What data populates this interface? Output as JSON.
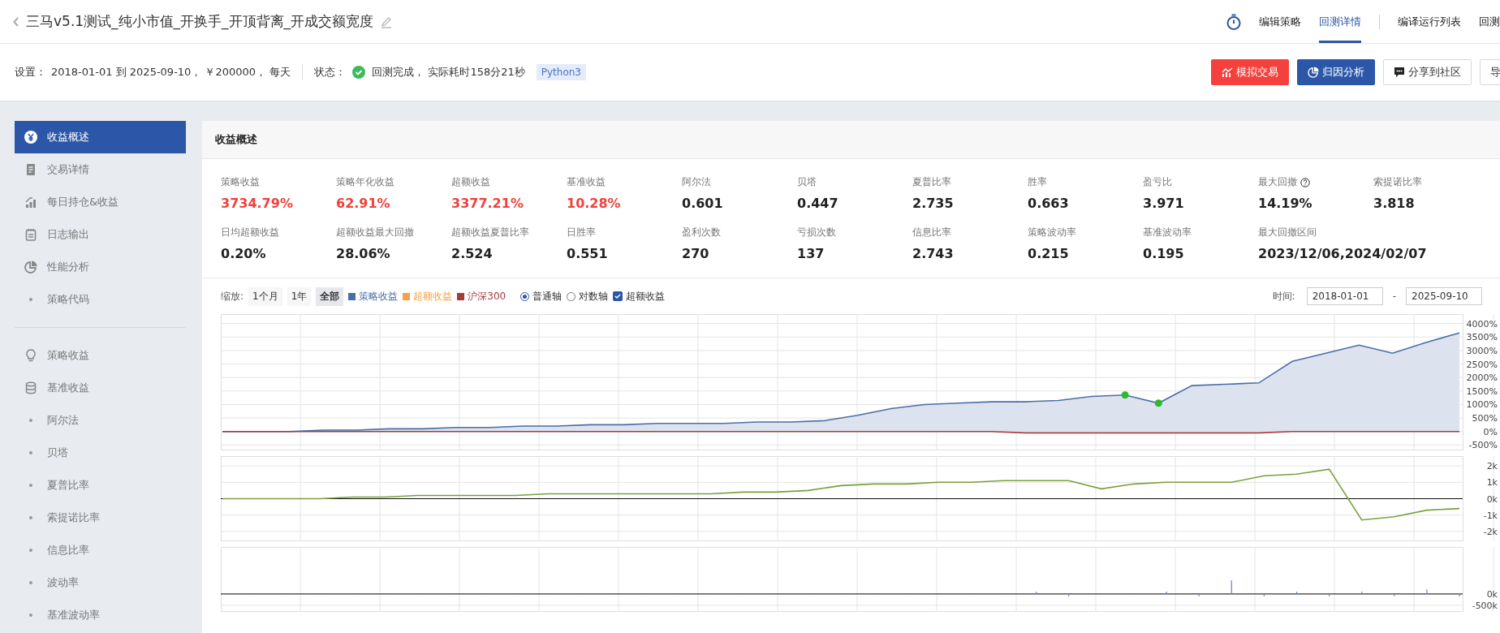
{
  "header": {
    "title": "三马v5.1测试_纯小市值_开换手_开顶背离_开成交额宽度",
    "nav": [
      {
        "label": "编辑策略",
        "selected": false
      },
      {
        "label": "回测详情",
        "selected": true
      },
      {
        "label": "编译运行列表",
        "selected": false
      },
      {
        "label": "回测",
        "selected": false
      }
    ]
  },
  "settings": {
    "label": "设置：",
    "value": "2018-01-01 到 2025-09-10， ￥200000， 每天",
    "status_label": "状态：",
    "status": "回测完成，  实际耗时158分21秒",
    "language": "Python3"
  },
  "actions": [
    {
      "label": "模拟交易",
      "kind": "danger"
    },
    {
      "label": "归因分析",
      "kind": "primary"
    },
    {
      "label": "分享到社区",
      "kind": "plain"
    },
    {
      "label": "导",
      "kind": "plain"
    }
  ],
  "sidebar": {
    "groups": [
      [
        {
          "label": "收益概述",
          "kind": "icon",
          "selected": true
        },
        {
          "label": "交易详情",
          "kind": "icon",
          "selected": false
        },
        {
          "label": "每日持仓&收益",
          "kind": "icon",
          "selected": false
        },
        {
          "label": "日志输出",
          "kind": "icon",
          "selected": false
        },
        {
          "label": "性能分析",
          "kind": "icon",
          "selected": false
        },
        {
          "label": "策略代码",
          "kind": "bullet",
          "selected": false
        }
      ],
      [
        {
          "label": "策略收益",
          "kind": "icon",
          "selected": false
        },
        {
          "label": "基准收益",
          "kind": "icon",
          "selected": false
        },
        {
          "label": "阿尔法",
          "kind": "bullet",
          "selected": false
        },
        {
          "label": "贝塔",
          "kind": "bullet",
          "selected": false
        },
        {
          "label": "夏普比率",
          "kind": "bullet",
          "selected": false
        },
        {
          "label": "索提诺比率",
          "kind": "bullet",
          "selected": false
        },
        {
          "label": "信息比率",
          "kind": "bullet",
          "selected": false
        },
        {
          "label": "波动率",
          "kind": "bullet",
          "selected": false
        },
        {
          "label": "基准波动率",
          "kind": "bullet",
          "selected": false
        }
      ]
    ]
  },
  "panel": {
    "title": "收益概述",
    "metrics": [
      {
        "label": "策略收益",
        "value": "3734.79%",
        "highlight": true
      },
      {
        "label": "策略年化收益",
        "value": "62.91%",
        "highlight": true
      },
      {
        "label": "超额收益",
        "value": "3377.21%",
        "highlight": true
      },
      {
        "label": "基准收益",
        "value": "10.28%",
        "highlight": true
      },
      {
        "label": "阿尔法",
        "value": "0.601",
        "highlight": false
      },
      {
        "label": "贝塔",
        "value": "0.447",
        "highlight": false
      },
      {
        "label": "夏普比率",
        "value": "2.735",
        "highlight": false
      },
      {
        "label": "胜率",
        "value": "0.663",
        "highlight": false
      },
      {
        "label": "盈亏比",
        "value": "3.971",
        "highlight": false
      },
      {
        "label": "最大回撤",
        "value": "14.19%",
        "highlight": false,
        "help": true
      },
      {
        "label": "索提诺比率",
        "value": "3.818",
        "highlight": false
      },
      {
        "label": "日均超额收益",
        "value": "0.20%",
        "highlight": false
      },
      {
        "label": "超额收益最大回撤",
        "value": "28.06%",
        "highlight": false
      },
      {
        "label": "超额收益夏普比率",
        "value": "2.524",
        "highlight": false
      },
      {
        "label": "日胜率",
        "value": "0.551",
        "highlight": false
      },
      {
        "label": "盈利次数",
        "value": "270",
        "highlight": false
      },
      {
        "label": "亏损次数",
        "value": "137",
        "highlight": false
      },
      {
        "label": "信息比率",
        "value": "2.743",
        "highlight": false
      },
      {
        "label": "策略波动率",
        "value": "0.215",
        "highlight": false
      },
      {
        "label": "基准波动率",
        "value": "0.195",
        "highlight": false
      },
      {
        "label": "最大回撤区间",
        "value": "2023/12/06,2024/02/07",
        "highlight": false
      }
    ]
  },
  "toolbar": {
    "zoom_label": "缩放:",
    "zoom_options": [
      {
        "label": "1个月",
        "selected": false
      },
      {
        "label": "1年",
        "selected": false
      },
      {
        "label": "全部",
        "selected": true
      }
    ],
    "legend": [
      {
        "label": "策略收益",
        "color": "#4a6ea8"
      },
      {
        "label": "超额收益",
        "color": "#f7a046"
      },
      {
        "label": "沪深300",
        "color": "#a83a3a"
      }
    ],
    "axis_options": [
      {
        "label": "普通轴",
        "selected": true
      },
      {
        "label": "对数轴",
        "selected": false
      }
    ],
    "excess": {
      "label": "超额收益",
      "checked": true
    },
    "time_label": "时间:",
    "start": "2018-01-01",
    "separator": "-",
    "end": "2025-09-10"
  },
  "charts": [
    {
      "chart_data": {
        "type": "area",
        "grid": true,
        "ylim": [
          -700,
          4350
        ],
        "yticks": [
          {
            "value": 4000,
            "label": "4000%"
          },
          {
            "value": 3500,
            "label": "3500%"
          },
          {
            "value": 3000,
            "label": "3000%"
          },
          {
            "value": 2500,
            "label": "2500%"
          },
          {
            "value": 2000,
            "label": "2000%"
          },
          {
            "value": 1500,
            "label": "1500%"
          },
          {
            "value": 1000,
            "label": "1000%"
          },
          {
            "value": 500,
            "label": "500%"
          },
          {
            "value": 0,
            "label": "0%"
          },
          {
            "value": -500,
            "label": "-500%"
          }
        ],
        "series": [
          {
            "type": "area",
            "color": "#4a6ea8",
            "values": [
              0,
              0,
              0,
              50,
              50,
              100,
              100,
              150,
              150,
              200,
              200,
              250,
              250,
              300,
              300,
              300,
              350,
              350,
              400,
              600,
              850,
              1000,
              1050,
              1100,
              1100,
              1150,
              1300,
              1350,
              1050,
              1700,
              1750,
              1800,
              2600,
              2900,
              3200,
              2900,
              3300,
              3650
            ]
          },
          {
            "type": "line",
            "color": "#a83a3a",
            "values": [
              0,
              0,
              0,
              0,
              0,
              0,
              0,
              0,
              0,
              0,
              0,
              0,
              0,
              0,
              0,
              0,
              0,
              0,
              0,
              0,
              0,
              0,
              0,
              0,
              -50,
              -50,
              -50,
              -50,
              -50,
              -50,
              -50,
              -50,
              0,
              0,
              0,
              0,
              0,
              0
            ]
          }
        ]
      }
    },
    {
      "chart_data": {
        "type": "line",
        "grid": true,
        "ylim": [
          -2600,
          2600
        ],
        "yticks": [
          {
            "value": 2000,
            "label": "2k"
          },
          {
            "value": 1000,
            "label": "1k"
          },
          {
            "value": 0,
            "label": "0k"
          },
          {
            "value": -1000,
            "label": "-1k"
          },
          {
            "value": -2000,
            "label": "-2k"
          }
        ],
        "series": [
          {
            "type": "line",
            "color": "#7aa03c",
            "values": [
              0,
              0,
              0,
              0,
              100,
              100,
              200,
              200,
              200,
              200,
              300,
              300,
              300,
              300,
              300,
              300,
              400,
              400,
              500,
              800,
              900,
              900,
              1000,
              1000,
              1100,
              1100,
              1100,
              600,
              900,
              1000,
              1000,
              1000,
              1400,
              1500,
              1800,
              -1300,
              -1100,
              -700,
              -600
            ]
          }
        ]
      }
    },
    {
      "chart_data": {
        "type": "bar",
        "grid": true,
        "ylim": [
          -790,
          2070
        ],
        "yticks": [
          {
            "value": 0,
            "label": "0k"
          },
          {
            "value": -500,
            "label": "-500k"
          }
        ],
        "series": [
          {
            "type": "bar",
            "color": "#5b86c5",
            "values": [
              0,
              0,
              0,
              0,
              0,
              0,
              0,
              0,
              0,
              0,
              0,
              0,
              0,
              0,
              0,
              0,
              0,
              0,
              0,
              0,
              0,
              0,
              0,
              0,
              0,
              100,
              -100,
              0,
              0,
              100,
              -100,
              600,
              -100,
              100,
              -100,
              100,
              -100,
              200,
              -100
            ]
          }
        ]
      }
    }
  ]
}
